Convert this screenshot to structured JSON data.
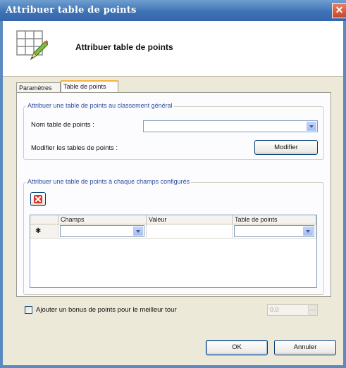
{
  "window": {
    "title": "Attribuer table de points",
    "close_glyph": "✕"
  },
  "header": {
    "title": "Attribuer table de points",
    "icon": "table-edit-icon"
  },
  "tabs": [
    {
      "label": "Paramètres",
      "active": false
    },
    {
      "label": "Table de points",
      "active": true
    }
  ],
  "general": {
    "legend": "Attribuer une table de points au classement général",
    "name_label": "Nom table de points :",
    "name_value": "",
    "modify_label": "Modifier les tables de points :",
    "modify_button": "Modifier"
  },
  "fields": {
    "legend": "Attribuer une table de points à chaque champs configurés",
    "delete_icon": "delete-icon",
    "columns": [
      "Champs",
      "Valeur",
      "Table de points"
    ],
    "rows": [
      {
        "marker": "✱",
        "champs": "",
        "valeur": "",
        "table": ""
      }
    ]
  },
  "bonus": {
    "label": "Ajouter un bonus de points pour le meilleur tour",
    "checked": false,
    "value": "0.0"
  },
  "footer": {
    "ok": "OK",
    "cancel": "Annuler"
  },
  "colors": {
    "titlebar": "#3f73b5",
    "accent_tab": "#f4b43a",
    "group_legend": "#2e4f9e",
    "close": "#c8452a"
  }
}
